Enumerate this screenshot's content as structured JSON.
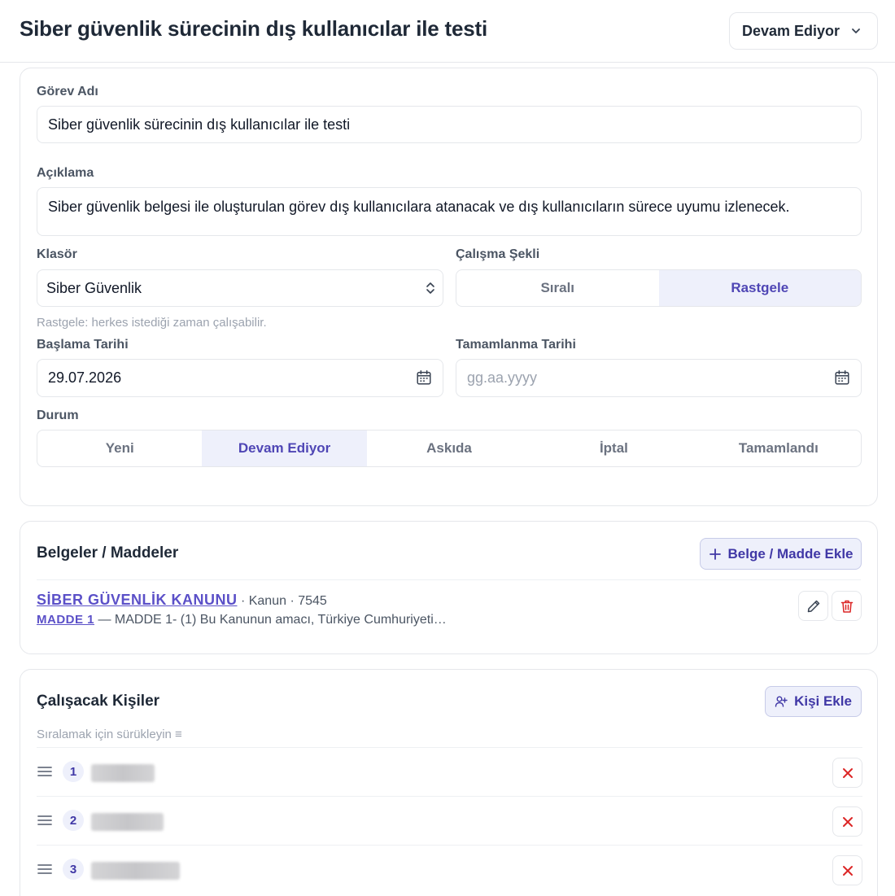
{
  "header": {
    "title": "Siber güvenlik sürecinin dış kullanıcılar ile testi",
    "status_dropdown": "Devam Ediyor"
  },
  "form": {
    "task_name_label": "Görev Adı",
    "task_name_value": "Siber güvenlik sürecinin dış kullanıcılar ile testi",
    "description_label": "Açıklama",
    "description_value": "Siber güvenlik belgesi ile oluşturulan görev dış kullanıcılara atanacak ve dış kullanıcıların sürece uyumu izlenecek.",
    "folder_label": "Klasör",
    "folder_value": "Siber Güvenlik",
    "work_mode_label": "Çalışma Şekli",
    "work_mode_options": [
      "Sıralı",
      "Rastgele"
    ],
    "work_mode_selected": "Rastgele",
    "work_mode_hint": "Rastgele: herkes istediği zaman çalışabilir.",
    "start_date_label": "Başlama Tarihi",
    "start_date_value": "29.07.2026",
    "end_date_label": "Tamamlanma Tarihi",
    "end_date_placeholder": "gg.aa.yyyy",
    "status_label": "Durum",
    "status_options": [
      "Yeni",
      "Devam Ediyor",
      "Askıda",
      "İptal",
      "Tamamlandı"
    ],
    "status_selected": "Devam Ediyor"
  },
  "documents": {
    "title": "Belgeler / Maddeler",
    "add_button": "Belge / Madde Ekle",
    "items": [
      {
        "name": "SİBER GÜVENLİK KANUNU",
        "meta": " · Kanun · 7545",
        "article": "MADDE 1",
        "excerpt": " — MADDE 1- (1) Bu Kanunun amacı, Türkiye Cumhuriyeti…"
      }
    ]
  },
  "people": {
    "title": "Çalışacak Kişiler",
    "add_button": "Kişi Ekle",
    "drag_hint": "Sıralamak için sürükleyin ≡",
    "rows": [
      {
        "order": "1"
      },
      {
        "order": "2"
      },
      {
        "order": "3"
      }
    ]
  },
  "colors": {
    "accent": "#4f46b5",
    "accent_bg": "#eef0fb",
    "danger": "#dc2626"
  }
}
